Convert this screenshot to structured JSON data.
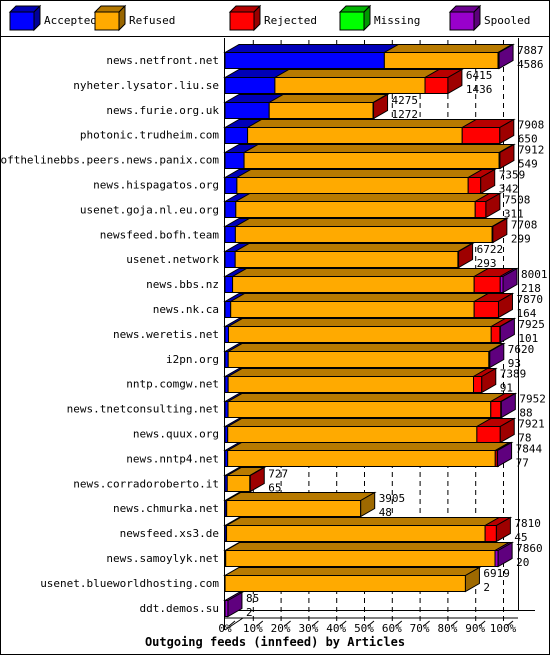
{
  "chart_data": {
    "type": "bar",
    "orientation": "horizontal",
    "stacked": true,
    "style": "3d",
    "xlabel": "Outgoing feeds (innfeed) by Articles",
    "x_tick_labels": [
      "0%",
      "10%",
      "20%",
      "30%",
      "40%",
      "50%",
      "60%",
      "70%",
      "80%",
      "90%",
      "100%"
    ],
    "grid": "vertical dashed",
    "legend_position": "top",
    "series": [
      {
        "name": "Accepted",
        "color": "#0000ff"
      },
      {
        "name": "Refused",
        "color": "#ffaa00"
      },
      {
        "name": "Rejected",
        "color": "#ff0000"
      },
      {
        "name": "Missing",
        "color": "#00ff00"
      },
      {
        "name": "Spooled",
        "color": "#9900cc"
      }
    ],
    "axis_max_articles": 8000,
    "feeds": [
      {
        "name": "news.netfront.net",
        "total": 7887,
        "accepted": 4586,
        "refused": 3270,
        "rejected": 0,
        "missing": 0,
        "spooled": 31
      },
      {
        "name": "nyheter.lysator.liu.se",
        "total": 6415,
        "accepted": 1436,
        "refused": 4320,
        "rejected": 659,
        "missing": 0,
        "spooled": 0
      },
      {
        "name": "news.furie.org.uk",
        "total": 4275,
        "accepted": 1272,
        "refused": 2990,
        "rejected": 13,
        "missing": 0,
        "spooled": 0
      },
      {
        "name": "photonic.trudheim.com",
        "total": 7908,
        "accepted": 650,
        "refused": 6176,
        "rejected": 1082,
        "missing": 0,
        "spooled": 0
      },
      {
        "name": "endofthelinebbs.peers.news.panix.com",
        "total": 7912,
        "accepted": 549,
        "refused": 7340,
        "rejected": 23,
        "missing": 0,
        "spooled": 0
      },
      {
        "name": "news.hispagatos.org",
        "total": 7359,
        "accepted": 342,
        "refused": 6656,
        "rejected": 361,
        "missing": 0,
        "spooled": 0
      },
      {
        "name": "usenet.goja.nl.eu.org",
        "total": 7508,
        "accepted": 311,
        "refused": 6889,
        "rejected": 308,
        "missing": 0,
        "spooled": 0
      },
      {
        "name": "newsfeed.bofh.team",
        "total": 7708,
        "accepted": 299,
        "refused": 7389,
        "rejected": 20,
        "missing": 0,
        "spooled": 0
      },
      {
        "name": "usenet.network",
        "total": 6722,
        "accepted": 293,
        "refused": 6410,
        "rejected": 19,
        "missing": 0,
        "spooled": 0
      },
      {
        "name": "news.bbs.nz",
        "total": 8001,
        "accepted": 218,
        "refused": 6952,
        "rejected": 750,
        "missing": 0,
        "spooled": 81
      },
      {
        "name": "news.nk.ca",
        "total": 7870,
        "accepted": 164,
        "refused": 7006,
        "rejected": 700,
        "missing": 0,
        "spooled": 0
      },
      {
        "name": "news.weretis.net",
        "total": 7925,
        "accepted": 101,
        "refused": 7560,
        "rejected": 250,
        "missing": 0,
        "spooled": 14
      },
      {
        "name": "i2pn.org",
        "total": 7620,
        "accepted": 93,
        "refused": 7500,
        "rejected": 0,
        "missing": 0,
        "spooled": 27
      },
      {
        "name": "nntp.comgw.net",
        "total": 7389,
        "accepted": 91,
        "refused": 7060,
        "rejected": 238,
        "missing": 0,
        "spooled": 0
      },
      {
        "name": "news.tnetconsulting.net",
        "total": 7952,
        "accepted": 88,
        "refused": 7560,
        "rejected": 290,
        "missing": 0,
        "spooled": 14
      },
      {
        "name": "news.quux.org",
        "total": 7921,
        "accepted": 78,
        "refused": 7170,
        "rejected": 673,
        "missing": 0,
        "spooled": 0
      },
      {
        "name": "news.nntp4.net",
        "total": 7844,
        "accepted": 77,
        "refused": 7700,
        "rejected": 60,
        "missing": 0,
        "spooled": 7
      },
      {
        "name": "news.corradoroberto.it",
        "total": 727,
        "accepted": 65,
        "refused": 650,
        "rejected": 12,
        "missing": 0,
        "spooled": 0
      },
      {
        "name": "news.chmurka.net",
        "total": 3905,
        "accepted": 48,
        "refused": 3857,
        "rejected": 0,
        "missing": 0,
        "spooled": 0
      },
      {
        "name": "newsfeed.xs3.de",
        "total": 7810,
        "accepted": 45,
        "refused": 7440,
        "rejected": 325,
        "missing": 0,
        "spooled": 0
      },
      {
        "name": "news.samoylyk.net",
        "total": 7860,
        "accepted": 20,
        "refused": 7750,
        "rejected": 0,
        "missing": 0,
        "spooled": 90
      },
      {
        "name": "usenet.blueworldhosting.com",
        "total": 6919,
        "accepted": 2,
        "refused": 6917,
        "rejected": 0,
        "missing": 0,
        "spooled": 0
      },
      {
        "name": "ddt.demos.su",
        "total": 85,
        "accepted": 2,
        "refused": 0,
        "rejected": 0,
        "missing": 0,
        "spooled": 83
      }
    ]
  }
}
